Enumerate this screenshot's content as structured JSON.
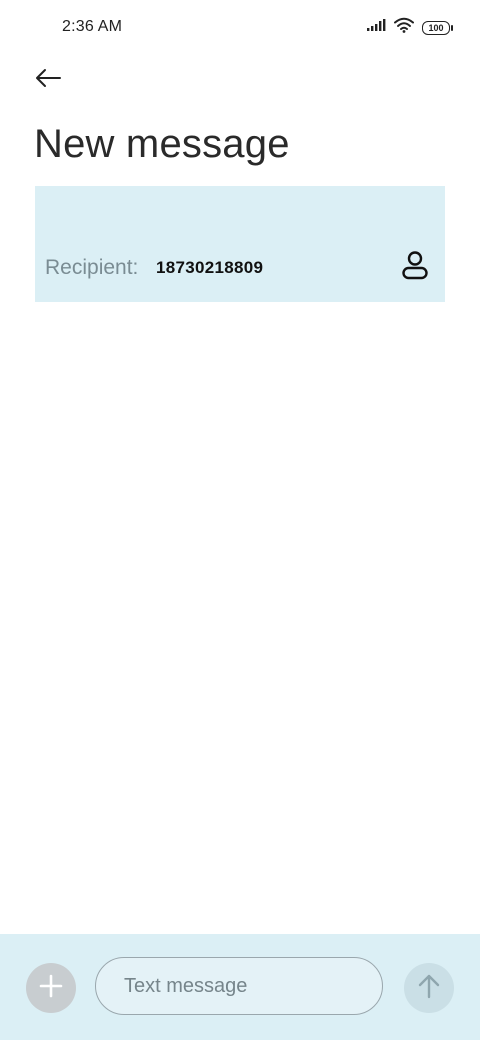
{
  "status_bar": {
    "time": "2:36 AM",
    "battery": "100",
    "icons": [
      "signal-icon",
      "wifi-icon",
      "battery-icon"
    ]
  },
  "header": {
    "back_icon": "back-arrow-icon",
    "title": "New message"
  },
  "recipient": {
    "label": "Recipient:",
    "value": "18730218809",
    "contact_icon": "contact-icon"
  },
  "compose": {
    "attach_icon": "plus-icon",
    "placeholder": "Text message",
    "send_icon": "send-arrow-icon"
  },
  "colors": {
    "panel_bg": "#dbeff5",
    "attach_bg": "#c8cdd0",
    "send_bg": "#cadfe6"
  }
}
